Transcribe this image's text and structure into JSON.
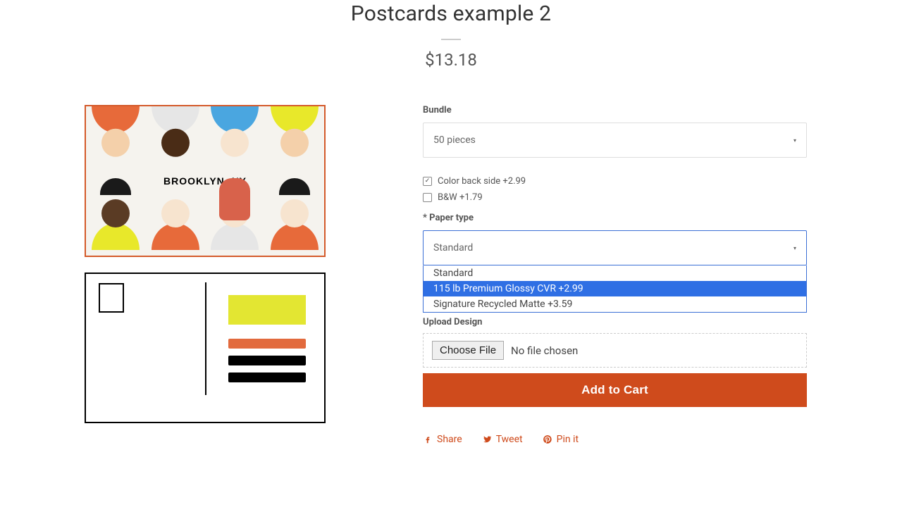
{
  "title": "Postcards example 2",
  "price": "$13.18",
  "product_image": {
    "caption": "BROOKLYN, NY"
  },
  "form": {
    "bundle": {
      "label": "Bundle",
      "selected": "50 pieces"
    },
    "color_back": {
      "label": "Color back side +2.99",
      "checked": true
    },
    "bw": {
      "label": "B&W +1.79",
      "checked": false
    },
    "paper": {
      "label": "Paper type",
      "selected": "Standard",
      "options": [
        "Standard",
        "115 lb Premium Glossy CVR +2.99",
        "Signature Recycled Matte +3.59"
      ],
      "highlighted_index": 1
    },
    "upload": {
      "label": "Upload Design",
      "button": "Choose File",
      "status": "No file chosen"
    },
    "add_to_cart": "Add to Cart"
  },
  "social": {
    "share": "Share",
    "tweet": "Tweet",
    "pin": "Pin it"
  }
}
